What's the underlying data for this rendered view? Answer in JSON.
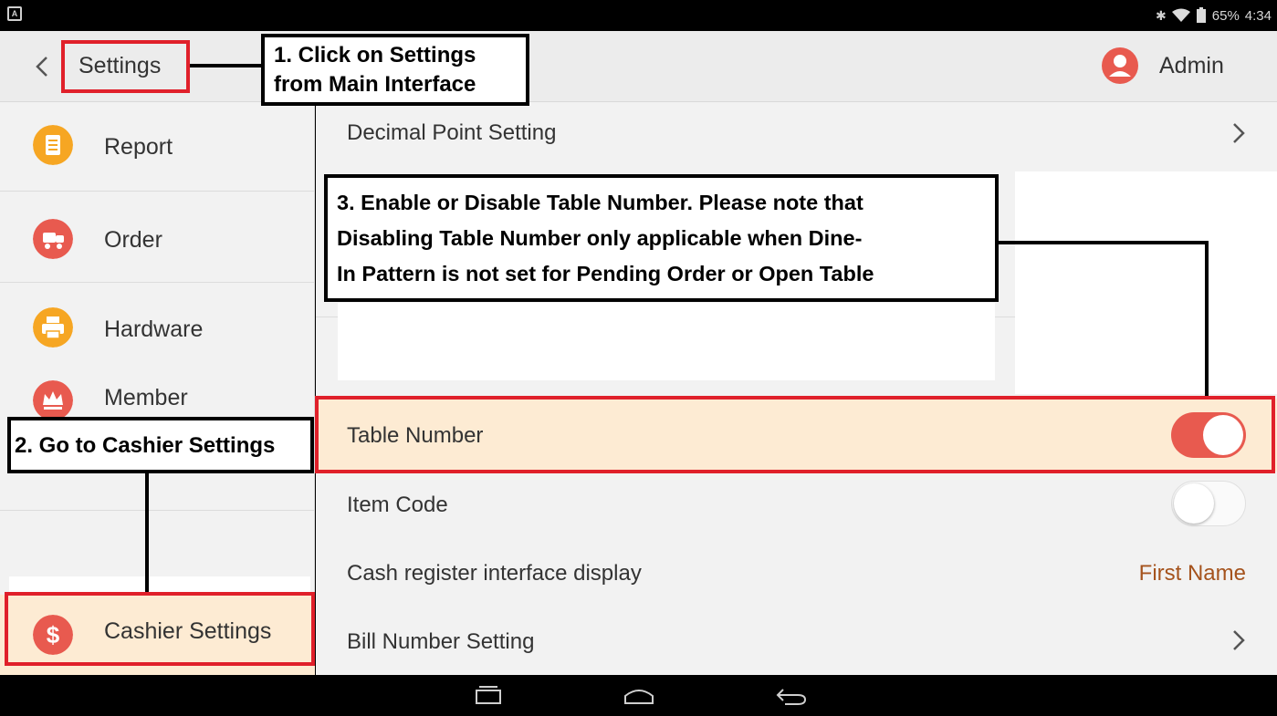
{
  "status_bar": {
    "left_icon_label": "A",
    "battery": "65%",
    "time": "4:34"
  },
  "header": {
    "back_icon": "chevron-left-icon",
    "title": "Settings",
    "user_icon": "user-avatar-icon",
    "user_name": "Admin"
  },
  "sidebar": {
    "items": [
      {
        "label": "Report",
        "icon": "report-icon",
        "color": "#f6a623"
      },
      {
        "label": "Order",
        "icon": "order-icon",
        "color": "#e85a4f"
      },
      {
        "label": "Hardware",
        "icon": "printer-icon",
        "color": "#f6a623"
      },
      {
        "label": "Member",
        "icon": "member-crown-icon",
        "color": "#e85a4f"
      },
      {
        "label": "Cashier Settings",
        "icon": "dollar-icon",
        "color": "#e85a4f"
      }
    ]
  },
  "content": {
    "decimal_point": "Decimal Point Setting",
    "table_number": {
      "label": "Table Number",
      "enabled": true
    },
    "item_code": {
      "label": "Item Code",
      "enabled": false
    },
    "cash_register_display": {
      "label": "Cash register interface display",
      "value": "First Name"
    },
    "bill_number": "Bill Number Setting"
  },
  "annotations": {
    "step1_line1": "1. Click on Settings",
    "step1_line2": "from Main Interface",
    "step2": "2. Go to Cashier Settings",
    "step3_line1": "3. Enable or Disable Table Number. Please note that",
    "step3_line2": "Disabling Table Number only applicable when Dine-",
    "step3_line3": "In Pattern is not set for Pending Order or Open Table"
  },
  "colors": {
    "accent": "#e85a4f",
    "highlight": "#fdebd3",
    "annotation_red": "#e0202a"
  }
}
